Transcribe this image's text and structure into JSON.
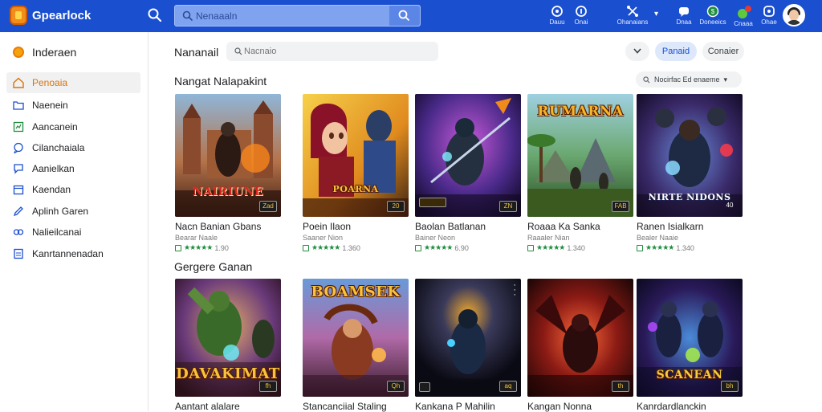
{
  "header": {
    "brand": "Gpearlock",
    "search_placeholder": "Nenaaaln",
    "nav": [
      {
        "icon": "gamepad-icon",
        "label": "Dauu"
      },
      {
        "icon": "info-icon",
        "label": "Onai"
      },
      {
        "icon": "network-icon",
        "label": "Ohanaians"
      },
      {
        "icon": "chat-icon",
        "label": "Dnaa"
      },
      {
        "icon": "gift-icon",
        "label": "Doneeics"
      },
      {
        "icon": "notification-icon",
        "label": "Cnaaa"
      },
      {
        "icon": "help-icon",
        "label": "Ohae"
      }
    ]
  },
  "sidebar": {
    "heading": "Inderaen",
    "items": [
      {
        "icon": "home-icon",
        "label": "Penoaia",
        "active": true
      },
      {
        "icon": "folder-icon",
        "label": "Naenein"
      },
      {
        "icon": "chart-icon",
        "label": "Aancanein"
      },
      {
        "icon": "chat-bubble-icon",
        "label": "Cilanchaiala"
      },
      {
        "icon": "comment-icon",
        "label": "Aanielkan"
      },
      {
        "icon": "calendar-icon",
        "label": "Kaendan"
      },
      {
        "icon": "pen-icon",
        "label": "Aplinh Garen"
      },
      {
        "icon": "link-icon",
        "label": "Nalieilcanai"
      },
      {
        "icon": "document-icon",
        "label": "Kanrtannenadan"
      }
    ]
  },
  "main": {
    "title": "Nananail",
    "filter_placeholder": "Nacnaio",
    "chip_primary": "Panaid",
    "chip_secondary": "Conaier",
    "section1": {
      "title": "Nangat Nalapakint",
      "sort_label": "Nocirfac Ed enaeme",
      "cards": [
        {
          "name": "Nacn Banian Gbans",
          "sub": "Bearar Naale",
          "count": "1.90",
          "art_title": "NAIRIUNE",
          "badge": "Zad"
        },
        {
          "name": "Poein Ilaon",
          "sub": "Saaner Nion",
          "count": "1.360",
          "art_title": "POARNA",
          "badge": "20"
        },
        {
          "name": "Baolan Batlanan",
          "sub": "Bainer Neon",
          "count": "6.90",
          "art_title": "",
          "badge": "ZN"
        },
        {
          "name": "Roaaa Ka Sanka",
          "sub": "Raaaler Nian",
          "count": "1.340",
          "art_title": "RUMARNA",
          "badge": "FAB"
        },
        {
          "name": "Ranen Isialkarn",
          "sub": "Bealer Naaie",
          "count": "1.340",
          "art_title": "NIRTE NIDONS",
          "badge": "40"
        }
      ]
    },
    "section2": {
      "title": "Gergere Ganan",
      "cards": [
        {
          "name": "Aantant alalare",
          "art_title": "DAVAKIMAT",
          "badge": "fh"
        },
        {
          "name": "Stancanciial Staling",
          "art_title": "BOAMSEK",
          "badge": "Qh"
        },
        {
          "name": "Kankana P Mahilin",
          "art_title": "",
          "badge": "aq"
        },
        {
          "name": "Kangan Nonna",
          "art_title": "",
          "badge": "th"
        },
        {
          "name": "Kanrdardlanckin",
          "art_title": "SCANEAN",
          "badge": "bh"
        }
      ]
    }
  }
}
